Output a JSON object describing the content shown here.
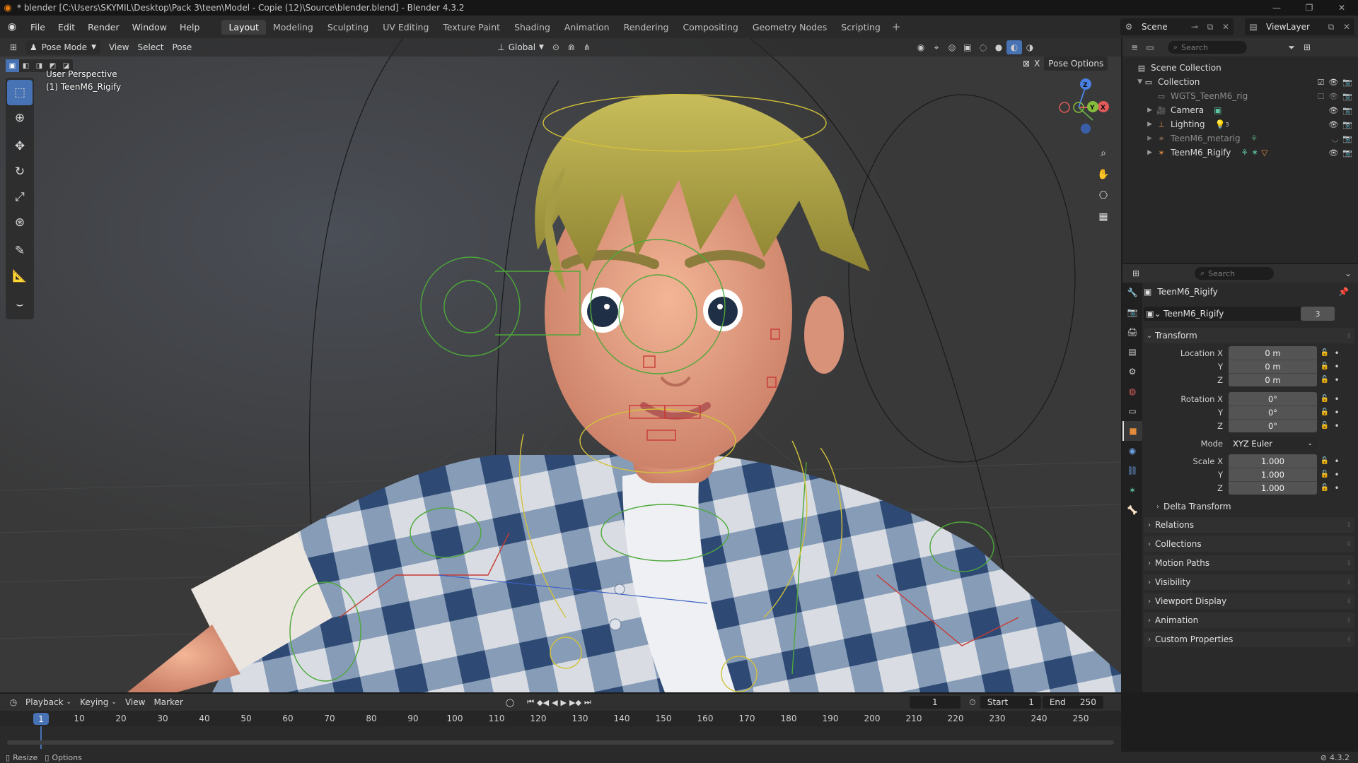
{
  "window": {
    "title": "* blender [C:\\Users\\SKYMIL\\Desktop\\Pack 3\\teen\\Model - Copie (12)\\Source\\blender.blend] - Blender 4.3.2"
  },
  "menu": [
    "File",
    "Edit",
    "Render",
    "Window",
    "Help"
  ],
  "workspaces": [
    "Layout",
    "Modeling",
    "Sculpting",
    "UV Editing",
    "Texture Paint",
    "Shading",
    "Animation",
    "Rendering",
    "Compositing",
    "Geometry Nodes",
    "Scripting"
  ],
  "active_workspace": "Layout",
  "scene_name": "Scene",
  "view_layer": "ViewLayer",
  "viewport": {
    "mode": "Pose Mode",
    "menus": [
      "View",
      "Select",
      "Pose"
    ],
    "orientation": "Global",
    "pose_options": "Pose Options",
    "info_line1": "User Perspective",
    "info_line2": "(1) TeenM6_Rigify",
    "gizmo": {
      "x": "X",
      "y": "Y",
      "z": "Z"
    }
  },
  "outliner": {
    "search_placeholder": "Search",
    "scene_collection": "Scene Collection",
    "rows": [
      {
        "name": "Collection"
      },
      {
        "name": "WGTS_TeenM6_rig"
      },
      {
        "name": "Camera"
      },
      {
        "name": "Lighting"
      },
      {
        "name": "TeenM6_metarig"
      },
      {
        "name": "TeenM6_Rigify"
      }
    ],
    "lighting_count": "3"
  },
  "properties": {
    "search_placeholder": "Search",
    "object_name": "TeenM6_Rigify",
    "datablock_name": "TeenM6_Rigify",
    "users": "3",
    "transform_label": "Transform",
    "location": {
      "label_x": "Location X",
      "label_y": "Y",
      "label_z": "Z",
      "x": "0 m",
      "y": "0 m",
      "z": "0 m"
    },
    "rotation": {
      "label_x": "Rotation X",
      "label_y": "Y",
      "label_z": "Z",
      "x": "0°",
      "y": "0°",
      "z": "0°"
    },
    "mode_label": "Mode",
    "mode_value": "XYZ Euler",
    "scale": {
      "label_x": "Scale X",
      "label_y": "Y",
      "label_z": "Z",
      "x": "1.000",
      "y": "1.000",
      "z": "1.000"
    },
    "delta_transform": "Delta Transform",
    "panels": [
      "Relations",
      "Collections",
      "Motion Paths",
      "Visibility",
      "Viewport Display",
      "Animation",
      "Custom Properties"
    ]
  },
  "timeline": {
    "menus": [
      "Playback",
      "Keying",
      "View",
      "Marker"
    ],
    "current_frame": "1",
    "start_label": "Start",
    "start": "1",
    "end_label": "End",
    "end": "250",
    "ruler": [
      "10",
      "20",
      "30",
      "40",
      "50",
      "60",
      "70",
      "80",
      "90",
      "100",
      "110",
      "120",
      "130",
      "140",
      "150",
      "160",
      "170",
      "180",
      "190",
      "200",
      "210",
      "220",
      "230",
      "240",
      "250"
    ],
    "playhead": "1"
  },
  "statusbar": {
    "resize": "Resize",
    "options": "Options",
    "version": "4.3.2"
  }
}
